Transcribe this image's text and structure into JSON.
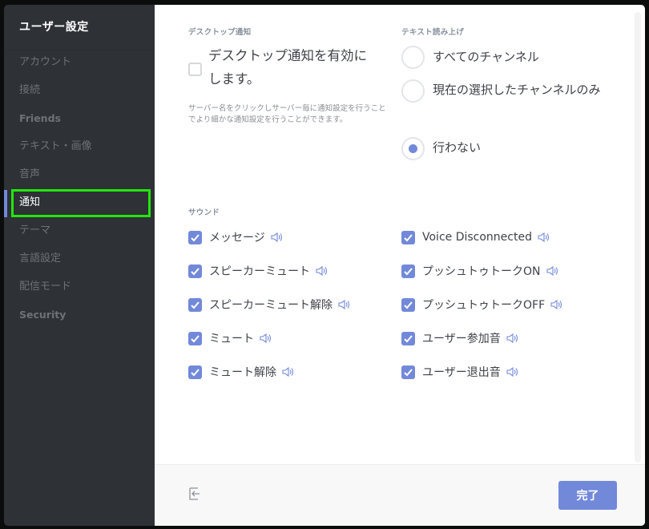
{
  "sidebar": {
    "title": "ユーザー設定",
    "items": [
      {
        "label": "アカウント"
      },
      {
        "label": "接続"
      },
      {
        "label": "Friends"
      },
      {
        "label": "テキスト・画像"
      },
      {
        "label": "音声"
      },
      {
        "label": "通知",
        "active": true
      },
      {
        "label": "テーマ"
      },
      {
        "label": "言語設定"
      },
      {
        "label": "配信モード"
      },
      {
        "label": "Security"
      }
    ]
  },
  "desktop": {
    "section_label": "デスクトップ通知",
    "checkbox_label": "デスクトップ通知を有効にします。",
    "checked": false,
    "hint": "サーバー名をクリックしサーバー毎に通知設定を行うことでより細かな通知設定を行うことができます。"
  },
  "tts": {
    "section_label": "テキスト読み上げ",
    "options": [
      {
        "label": "すべてのチャンネル",
        "selected": false
      },
      {
        "label": "現在の選択したチャンネルのみ",
        "selected": false
      },
      {
        "label": "行わない",
        "selected": true
      }
    ]
  },
  "sounds": {
    "section_label": "サウンド",
    "left": [
      {
        "label": "メッセージ",
        "checked": true
      },
      {
        "label": "スピーカーミュート",
        "checked": true
      },
      {
        "label": "スピーカーミュート解除",
        "checked": true
      },
      {
        "label": "ミュート",
        "checked": true
      },
      {
        "label": "ミュート解除",
        "checked": true
      }
    ],
    "right": [
      {
        "label": "Voice Disconnected",
        "checked": true
      },
      {
        "label": "プッシュトゥトークON",
        "checked": true
      },
      {
        "label": "プッシュトゥトークOFF",
        "checked": true
      },
      {
        "label": "ユーザー参加音",
        "checked": true
      },
      {
        "label": "ユーザー退出音",
        "checked": true
      }
    ]
  },
  "footer": {
    "logout_icon": "logout-icon",
    "done_label": "完了"
  },
  "colors": {
    "accent": "#7289da",
    "sidebar_bg": "#2e3136",
    "highlight": "#22e60c"
  }
}
